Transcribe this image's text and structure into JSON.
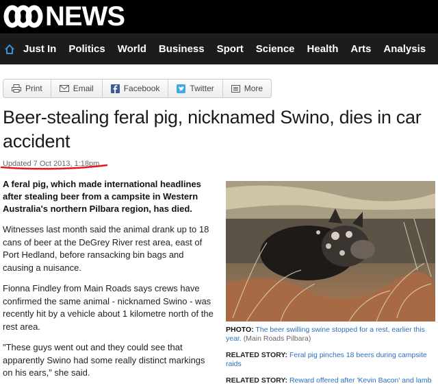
{
  "header": {
    "logo_text": "NEWS",
    "nav": [
      "Just In",
      "Politics",
      "World",
      "Business",
      "Sport",
      "Science",
      "Health",
      "Arts",
      "Analysis"
    ]
  },
  "share": {
    "buttons": [
      {
        "label": "Print",
        "icon": "print-icon"
      },
      {
        "label": "Email",
        "icon": "email-icon"
      },
      {
        "label": "Facebook",
        "icon": "facebook-icon"
      },
      {
        "label": "Twitter",
        "icon": "twitter-icon"
      },
      {
        "label": "More",
        "icon": "more-icon"
      }
    ]
  },
  "article": {
    "headline": "Beer-stealing feral pig, nicknamed Swino, dies in car accident",
    "updated": "Updated 7 Oct 2013, 1:18pm",
    "lede": "A feral pig, which made international headlines after stealing beer from a campsite in Western Australia's northern Pilbara region, has died.",
    "paragraphs": [
      "Witnesses last month said the animal drank up to 18 cans of beer at the DeGrey River rest area, east of Port Hedland, before ransacking bin bags and causing a nuisance.",
      "Fionna Findley from Main Roads says crews have confirmed the same animal - nicknamed Swino - was recently hit by a vehicle about 1 kilometre north of the rest area.",
      "\"These guys went out and they could see that apparently Swino had some really distinct markings on his ears,\" she said."
    ]
  },
  "photo": {
    "caption_label": "PHOTO:",
    "caption_text": "The beer swilling swine stopped for a rest, earlier this year.",
    "caption_credit": "(Main Roads Pilbara)"
  },
  "related": [
    {
      "label": "RELATED STORY:",
      "text": "Feral pig pinches 18 beers during campsite raids"
    },
    {
      "label": "RELATED STORY:",
      "text": "Reward offered after 'Kevin Bacon' and lamb"
    }
  ],
  "colors": {
    "link": "#2a6ebb",
    "underline": "#e3191b",
    "masthead": "#000000",
    "nav": "#1c1c1c"
  }
}
